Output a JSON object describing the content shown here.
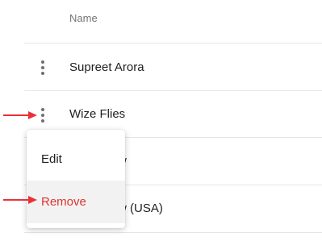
{
  "table": {
    "header": "Name",
    "rows": [
      {
        "name": "Supreet Arora"
      },
      {
        "name": "Wize Flies"
      },
      {
        "name": "w"
      },
      {
        "name": "w (USA)"
      }
    ]
  },
  "context_menu": {
    "edit_label": "Edit",
    "remove_label": "Remove"
  },
  "colors": {
    "arrow": "#e8323a",
    "remove_text": "#e0332f",
    "kebab": "#6f6f6f"
  },
  "icons": {
    "kebab": "more-vert-icon",
    "arrow": "red-arrow-icon"
  }
}
